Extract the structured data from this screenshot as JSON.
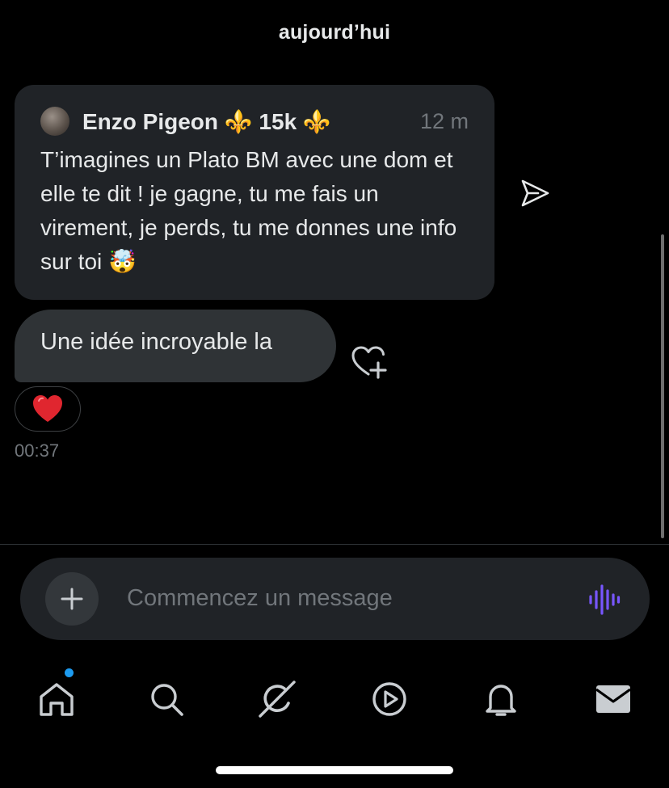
{
  "conversation": {
    "date_header": "aujourd’hui",
    "quoted_post": {
      "author": "Enzo Pigeon ⚜️ 15k ⚜️",
      "time": "12 m",
      "body": "T’imagines  un Plato BM avec une dom et elle te dit ! je gagne, tu me fais un virement, je perds, tu me donnes une info sur toi 🤯"
    },
    "message": {
      "text": "Une idée incroyable la",
      "reaction": "❤️",
      "timestamp": "00:37"
    }
  },
  "composer": {
    "placeholder": "Commencez un message"
  },
  "icons": {
    "share": "send-icon",
    "react": "heart-add-icon",
    "attach": "plus-icon",
    "voice": "voice-waveform-icon"
  },
  "tabbar": {
    "tabs": [
      "home-icon",
      "search-icon",
      "grok-icon",
      "video-icon",
      "notifications-icon",
      "messages-icon"
    ],
    "home_has_notification": true
  },
  "colors": {
    "background": "#000000",
    "bubble": "#2f3336",
    "quoted_bubble": "#202327",
    "muted_text": "#71767b",
    "accent_voice": "#7856ff",
    "notification_dot": "#1d9bf0"
  }
}
